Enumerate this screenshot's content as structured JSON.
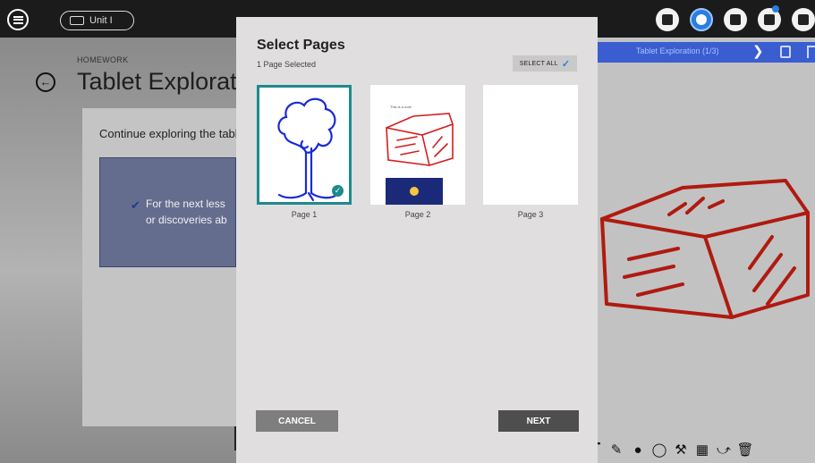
{
  "topbar": {
    "unit_label": "Unit I",
    "icons": [
      "menu-icon",
      "book-icon",
      "palette-icon",
      "compass-icon",
      "library-icon",
      "chat-icon",
      "clipboard-icon"
    ]
  },
  "left_page": {
    "section_label": "HOMEWORK",
    "title": "Tablet Exploratio",
    "intro_text": "Continue exploring the tabl",
    "task_lines": [
      "For the next less",
      "or discoveries ab"
    ]
  },
  "right_page": {
    "nav_text": "Tablet Exploration (1/3)",
    "drawing_color": "#b01a10"
  },
  "modal": {
    "title": "Select Pages",
    "selected_count": "1 Page Selected",
    "select_all_label": "SELECT ALL",
    "pages": [
      {
        "label": "Page 1",
        "selected": true
      },
      {
        "label": "Page 2",
        "selected": false,
        "mini_title": "This is a note"
      },
      {
        "label": "Page 3",
        "selected": false
      }
    ],
    "cancel_label": "CANCEL",
    "next_label": "NEXT",
    "accent_color": "#1e8a8e"
  },
  "toolbar": {
    "icons": [
      "shape-icon",
      "crop-icon",
      "text-icon",
      "pen-icon",
      "eraser-icon",
      "lasso-icon",
      "tool-icon",
      "grid-icon",
      "connector-icon",
      "trash-icon"
    ]
  }
}
